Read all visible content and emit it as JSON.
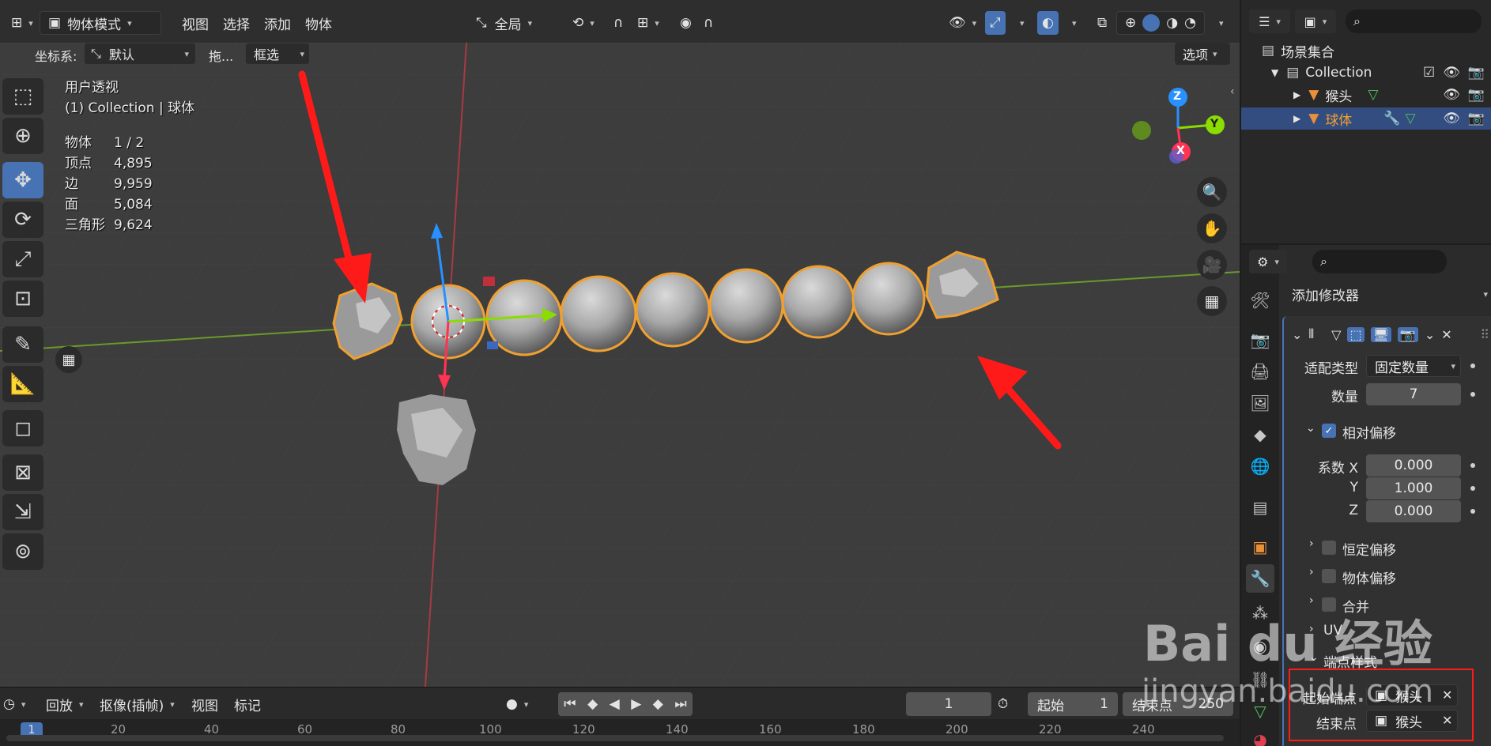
{
  "header": {
    "mode": "物体模式",
    "menus": [
      "视图",
      "选择",
      "添加",
      "物体"
    ],
    "transform_orientation": "全局",
    "options_label": "选项"
  },
  "toolbar2": {
    "coord_label": "坐标系:",
    "coord_value": "默认",
    "drag_label": "拖...",
    "select_mode": "框选"
  },
  "viewport": {
    "view_name": "用户透视",
    "collection_line": "(1) Collection | 球体",
    "stats": [
      {
        "label": "物体",
        "value": "1 / 2"
      },
      {
        "label": "顶点",
        "value": "4,895"
      },
      {
        "label": "边",
        "value": "9,959"
      },
      {
        "label": "面",
        "value": "5,084"
      },
      {
        "label": "三角形",
        "value": "9,624"
      }
    ],
    "gizmo_axes": {
      "z": "Z",
      "y": "Y",
      "x": "X"
    }
  },
  "outliner": {
    "scene_collection": "场景集合",
    "collection": "Collection",
    "items": [
      {
        "name": "猴头",
        "selected": false
      },
      {
        "name": "球体",
        "selected": true
      }
    ]
  },
  "properties": {
    "add_modifier": "添加修改器",
    "fit_type_label": "适配类型",
    "fit_type_value": "固定数量",
    "count_label": "数量",
    "count_value": "7",
    "relative_offset_label": "相对偏移",
    "factor_x_label": "系数 X",
    "factor_x": "0.000",
    "factor_y_label": "Y",
    "factor_y": "1.000",
    "factor_z_label": "Z",
    "factor_z": "0.000",
    "constant_offset": "恒定偏移",
    "object_offset": "物体偏移",
    "merge": "合并",
    "uv": "UV",
    "caps_section": "端点样式",
    "start_cap_label": "起始端点",
    "start_cap_value": "猴头",
    "end_cap_label": "结束点",
    "end_cap_value": "猴头"
  },
  "timeline": {
    "playback": "回放",
    "keying": "抠像(插帧)",
    "view": "视图",
    "marker": "标记",
    "current_frame": "1",
    "start_label": "起始",
    "start_value": "1",
    "end_label": "结束点",
    "end_value": "250",
    "ruler_labels": [
      "1",
      "20",
      "40",
      "60",
      "80",
      "100",
      "120",
      "140",
      "160",
      "180",
      "200",
      "220",
      "240"
    ]
  },
  "watermark": {
    "brand": "Bai du 经验",
    "url": "jingyan.baidu.com"
  },
  "colors": {
    "accent_blue": "#4772b3",
    "selection_orange": "#f0a030",
    "annotation_red": "#ff1a1a",
    "axis_x": "#ff3352",
    "axis_y": "#8bdc00",
    "axis_z": "#2890ff"
  }
}
